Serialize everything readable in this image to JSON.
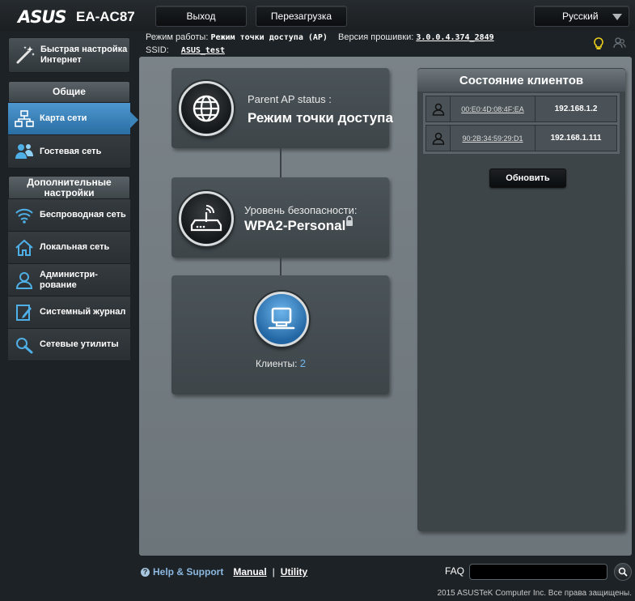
{
  "header": {
    "brand": "ASUS",
    "model": "EA-AC87",
    "logout_label": "Выход",
    "reboot_label": "Перезагрузка",
    "language": "Русский"
  },
  "status": {
    "mode_label": "Режим работы:",
    "mode_value": "Режим точки доступа (AP)",
    "firmware_label": "Версия прошивки:",
    "firmware_value": "3.0.0.4.374_2849",
    "ssid_label": "SSID:",
    "ssid_value": "ASUS_test"
  },
  "sidebar": {
    "quick_setup": "Быстрая настройка Интернет",
    "general_header": "Общие",
    "general_items": [
      {
        "label": "Карта сети",
        "icon": "network-map-icon",
        "active": true
      },
      {
        "label": "Гостевая сеть",
        "icon": "guest-network-icon",
        "active": false
      }
    ],
    "advanced_header": "Дополнительные настройки",
    "advanced_items": [
      {
        "label": "Беспроводная сеть",
        "icon": "wireless-icon"
      },
      {
        "label": "Локальная сеть",
        "icon": "lan-home-icon"
      },
      {
        "label": "Администри-рование",
        "icon": "admin-user-icon"
      },
      {
        "label": "Системный журнал",
        "icon": "system-log-icon"
      },
      {
        "label": "Сетевые утилиты",
        "icon": "network-tools-icon"
      }
    ]
  },
  "map": {
    "parent_label": "Parent AP status :",
    "parent_value": "Режим точки доступа",
    "security_label": "Уровень безопасности:",
    "security_value": "WPA2-Personal",
    "clients_label": "Клиенты:",
    "clients_count": "2"
  },
  "clients": {
    "title": "Состояние клиентов",
    "rows": [
      {
        "mac": "00:E0:4D:08:4F:EA",
        "ip": "192.168.1.2"
      },
      {
        "mac": "90:2B:34:59:29:D1",
        "ip": "192.168.1.111"
      }
    ],
    "refresh_label": "Обновить"
  },
  "footer": {
    "help_label": "Help & Support",
    "manual_label": "Manual",
    "utility_label": "Utility",
    "faq_label": "FAQ",
    "copyright": "2015 ASUSTeK Computer Inc. Все права защищены."
  },
  "colors": {
    "accent_blue": "#2a6ea3",
    "help_blue": "#8cb8e0",
    "panel_gray": "#3e4549"
  }
}
